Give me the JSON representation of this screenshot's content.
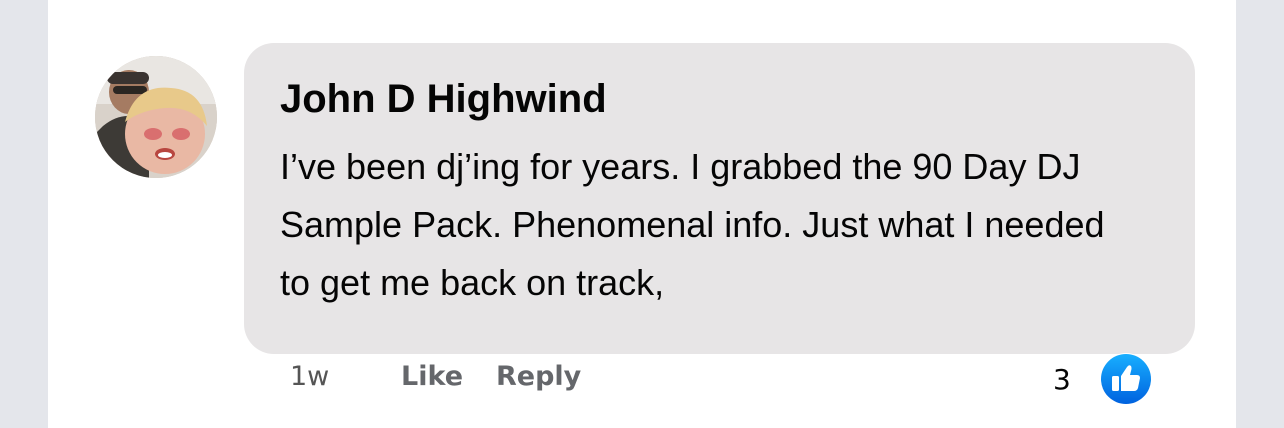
{
  "comment": {
    "author": "John D Highwind",
    "text": "I’ve been dj’ing for years. I grabbed the 90 Day DJ Sample Pack. Phenomenal info. Just what I needed to get me back on track,",
    "timestamp": "1w",
    "reaction_count": "3"
  },
  "actions": {
    "like_label": "Like",
    "reply_label": "Reply"
  },
  "icons": {
    "reaction": "thumbs-up-icon",
    "avatar": "profile-photo"
  },
  "colors": {
    "bubble": "#e7e5e6",
    "reaction_blue": "#1877f2",
    "meta_text": "#65676b"
  }
}
